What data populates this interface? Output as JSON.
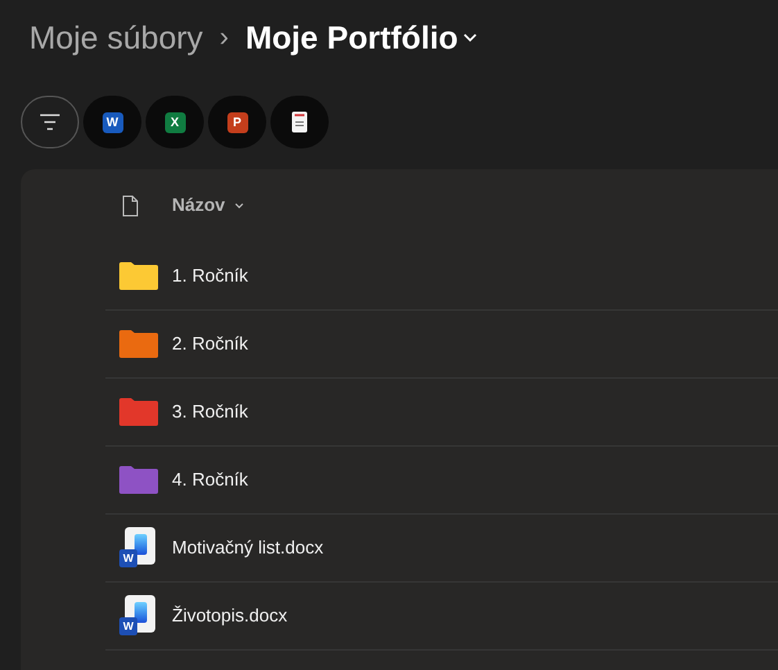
{
  "breadcrumb": {
    "parent": "Moje súbory",
    "separator": "›",
    "current": "Moje Portfólio"
  },
  "filters": [
    {
      "kind": "sort"
    },
    {
      "kind": "app",
      "label": "W",
      "color": "#185abd"
    },
    {
      "kind": "app",
      "label": "X",
      "color": "#107c41"
    },
    {
      "kind": "app",
      "label": "P",
      "color": "#c43e1c"
    },
    {
      "kind": "pdf"
    }
  ],
  "table": {
    "columns": [
      {
        "label": "Názov"
      }
    ],
    "rows": [
      {
        "kind": "folder",
        "name": "1. Ročník",
        "color": "#fcc934"
      },
      {
        "kind": "folder",
        "name": "2. Ročník",
        "color": "#ea6a10"
      },
      {
        "kind": "folder",
        "name": "3. Ročník",
        "color": "#e2372a"
      },
      {
        "kind": "folder",
        "name": "4. Ročník",
        "color": "#8e52c4"
      },
      {
        "kind": "file",
        "name": "Motivačný list.docx",
        "badge": "W"
      },
      {
        "kind": "file",
        "name": "Životopis.docx",
        "badge": "W"
      }
    ]
  }
}
